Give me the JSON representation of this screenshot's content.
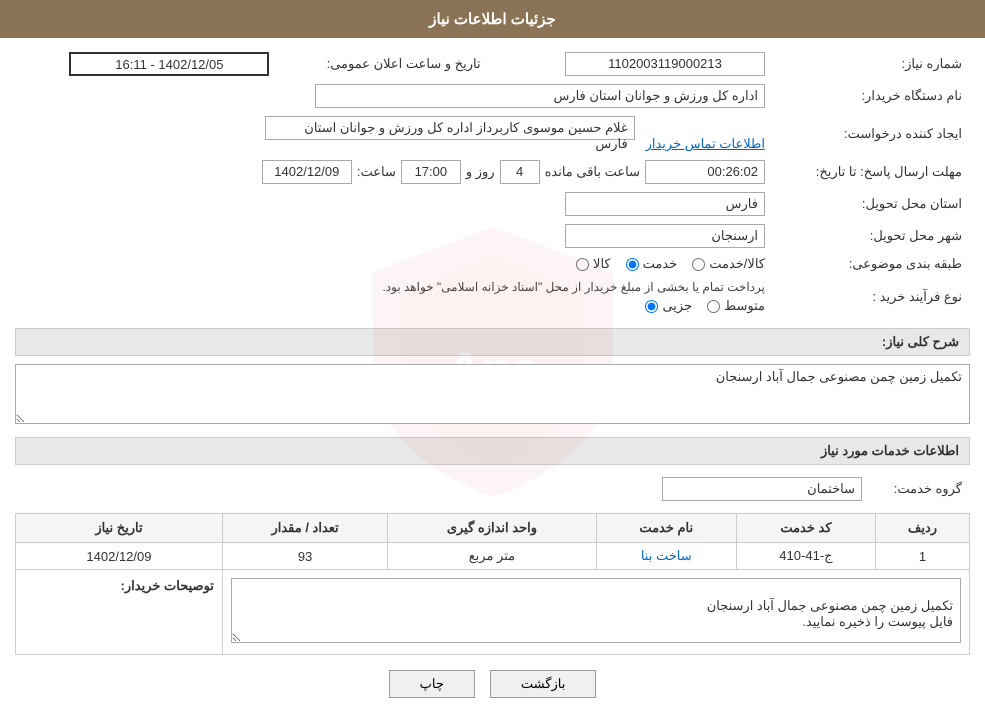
{
  "header": {
    "title": "جزئیات اطلاعات نیاز"
  },
  "form": {
    "need_number_label": "شماره نیاز:",
    "need_number_value": "1102003119000213",
    "announcement_label": "تاریخ و ساعت اعلان عمومی:",
    "announcement_value": "1402/12/05 - 16:11",
    "buyer_org_label": "نام دستگاه خریدار:",
    "buyer_org_value": "اداره کل ورزش و جوانان استان فارس",
    "creator_label": "ایجاد کننده درخواست:",
    "creator_value": "غلام حسین موسوی کاربرداز اداره کل ورزش و جوانان استان فارس",
    "creator_link": "اطلاعات تماس خریدار",
    "deadline_label": "مهلت ارسال پاسخ: تا تاریخ:",
    "deadline_date": "1402/12/09",
    "deadline_time_label": "ساعت:",
    "deadline_time": "17:00",
    "deadline_days_label": "روز و",
    "deadline_days": "4",
    "deadline_remain_label": "ساعت باقی مانده",
    "deadline_remain": "00:26:02",
    "province_label": "استان محل تحویل:",
    "province_value": "فارس",
    "city_label": "شهر محل تحویل:",
    "city_value": "ارسنجان",
    "category_label": "طبقه بندی موضوعی:",
    "category_options": [
      {
        "label": "کالا",
        "value": "kala"
      },
      {
        "label": "خدمت",
        "value": "khadamat"
      },
      {
        "label": "کالا/خدمت",
        "value": "kala_khadamat"
      }
    ],
    "category_selected": "khadamat",
    "purchase_type_label": "نوع فرآیند خرید :",
    "purchase_note": "پرداخت تمام یا بخشی از مبلغ خریدار از محل \"اسناد خزانه اسلامی\" خواهد بود.",
    "purchase_options": [
      {
        "label": "جزیی",
        "value": "jozei"
      },
      {
        "label": "متوسط",
        "value": "motavaset"
      }
    ],
    "purchase_selected": "jozei",
    "need_desc_label": "شرح کلی نیاز:",
    "need_desc_value": "تکمیل زمین چمن مصنوعی جمال آباد ارسنجان",
    "services_section_label": "اطلاعات خدمات مورد نیاز",
    "service_group_label": "گروه خدمت:",
    "service_group_value": "ساختمان",
    "table": {
      "headers": [
        "ردیف",
        "کد خدمت",
        "نام خدمت",
        "واحد اندازه گیری",
        "تعداد / مقدار",
        "تاریخ نیاز"
      ],
      "rows": [
        {
          "row": "1",
          "code": "ج-41-410",
          "name": "ساخت بنا",
          "unit": "متر مربع",
          "quantity": "93",
          "date": "1402/12/09"
        }
      ]
    },
    "buyer_desc_label": "توصیحات خریدار:",
    "buyer_desc_value": "تکمیل زمین چمن مصنوعی جمال آباد ارسنجان\nفایل پیوست را ذخیره نمایید.",
    "btn_print": "چاپ",
    "btn_back": "بازگشت"
  }
}
